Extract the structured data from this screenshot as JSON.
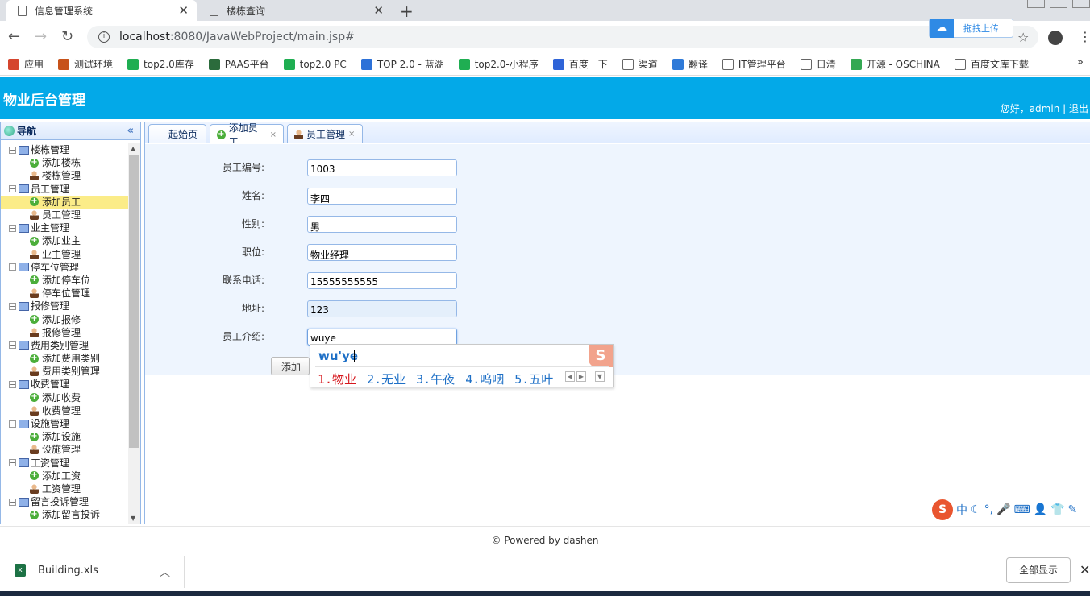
{
  "browser": {
    "tabs": [
      {
        "title": "信息管理系统",
        "active": true
      },
      {
        "title": "楼栋查询",
        "active": false
      }
    ],
    "url_host": "localhost",
    "url_path": ":8080/JavaWebProject/main.jsp#",
    "cloud_button": "拖拽上传",
    "bookmarks": [
      {
        "label": "应用",
        "color": "#d5452e"
      },
      {
        "label": "测试环境",
        "color": "#c7521a"
      },
      {
        "label": "top2.0库存",
        "color": "#1fae52"
      },
      {
        "label": "PAAS平台",
        "color": "#2b6b3c"
      },
      {
        "label": "top2.0 PC",
        "color": "#1fae52"
      },
      {
        "label": "TOP 2.0 - 蓝湖",
        "color": "#2c71d8"
      },
      {
        "label": "top2.0-小程序",
        "color": "#1fae52"
      },
      {
        "label": "百度一下",
        "color": "#2f64d8"
      },
      {
        "label": "渠道",
        "color": "#ffffff"
      },
      {
        "label": "翻译",
        "color": "#2f7ad8"
      },
      {
        "label": "IT管理平台",
        "color": "#ffffff"
      },
      {
        "label": "日清",
        "color": "#ffffff"
      },
      {
        "label": "开源 - OSCHINA",
        "color": "#34a853"
      },
      {
        "label": "百度文库下载",
        "color": "#ffffff"
      }
    ],
    "bookmarks_more": "»"
  },
  "app": {
    "title": "物业后台管理",
    "greeting": "您好，admin",
    "separator": " | ",
    "logout": "退出",
    "brand_color": "#03a9e8"
  },
  "nav": {
    "title": "导航",
    "collapse": "«",
    "tree": [
      {
        "label": "楼栋管理",
        "type": "group"
      },
      {
        "label": "添加楼栋",
        "type": "add"
      },
      {
        "label": "楼栋管理",
        "type": "manage"
      },
      {
        "label": "员工管理",
        "type": "group"
      },
      {
        "label": "添加员工",
        "type": "add",
        "selected": true
      },
      {
        "label": "员工管理",
        "type": "manage"
      },
      {
        "label": "业主管理",
        "type": "group"
      },
      {
        "label": "添加业主",
        "type": "add"
      },
      {
        "label": "业主管理",
        "type": "manage"
      },
      {
        "label": "停车位管理",
        "type": "group"
      },
      {
        "label": "添加停车位",
        "type": "add"
      },
      {
        "label": "停车位管理",
        "type": "manage"
      },
      {
        "label": "报修管理",
        "type": "group"
      },
      {
        "label": "添加报修",
        "type": "add"
      },
      {
        "label": "报修管理",
        "type": "manage"
      },
      {
        "label": "费用类别管理",
        "type": "group"
      },
      {
        "label": "添加费用类别",
        "type": "add"
      },
      {
        "label": "费用类别管理",
        "type": "manage"
      },
      {
        "label": "收费管理",
        "type": "group"
      },
      {
        "label": "添加收费",
        "type": "add"
      },
      {
        "label": "收费管理",
        "type": "manage"
      },
      {
        "label": "设施管理",
        "type": "group"
      },
      {
        "label": "添加设施",
        "type": "add"
      },
      {
        "label": "设施管理",
        "type": "manage"
      },
      {
        "label": "工资管理",
        "type": "group"
      },
      {
        "label": "添加工资",
        "type": "add"
      },
      {
        "label": "工资管理",
        "type": "manage"
      },
      {
        "label": "留言投诉管理",
        "type": "group"
      },
      {
        "label": "添加留言投诉",
        "type": "add"
      }
    ]
  },
  "tabs": {
    "start": "起始页",
    "add_employee": "添加员工",
    "employee_manage": "员工管理",
    "close": "×"
  },
  "form": {
    "fields": [
      {
        "label": "员工编号:",
        "value": "1003"
      },
      {
        "label": "姓名:",
        "value": "李四"
      },
      {
        "label": "性别:",
        "value": "男"
      },
      {
        "label": "职位:",
        "value": "物业经理"
      },
      {
        "label": "联系电话:",
        "value": "15555555555"
      },
      {
        "label": "地址:",
        "value": "123"
      },
      {
        "label": "员工介绍:",
        "value": "wuye"
      }
    ],
    "submit": "添加"
  },
  "ime": {
    "composition": "wu'ye",
    "candidates": [
      "1.物业",
      "2.无业",
      "3.午夜",
      "4.呜咽",
      "5.五叶"
    ],
    "logo": "S",
    "status_s": "S",
    "status_mode": "中"
  },
  "footer": {
    "text": "© Powered by dashen"
  },
  "download": {
    "file": "Building.xls",
    "show_all": "全部显示"
  }
}
